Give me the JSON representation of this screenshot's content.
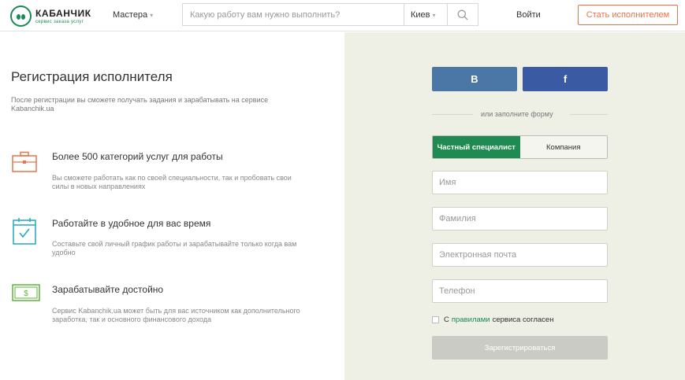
{
  "header": {
    "logo_name": "КАБАНЧИК",
    "logo_sub": "сервис заказа услуг",
    "masters_label": "Мастера",
    "search_placeholder": "Какую работу вам нужно выполнить?",
    "city": "Киев",
    "login_label": "Войти",
    "become_label": "Стать исполнителем"
  },
  "left": {
    "title": "Регистрация исполнителя",
    "intro": "После регистрации вы сможете получать задания и зарабатывать на сервисе Kabanchik.ua",
    "features": [
      {
        "icon": "briefcase-icon",
        "title": "Более 500 категорий услуг для работы",
        "desc": "Вы сможете работать как по своей специальности, так и пробовать свои силы в новых направлениях"
      },
      {
        "icon": "calendar-check-icon",
        "title": "Работайте в удобное для вас время",
        "desc": "Составьте свой личный график работы и зарабатывайте только когда вам удобно"
      },
      {
        "icon": "money-icon",
        "title": "Зарабатывайте достойно",
        "desc": "Сервис Kabanchik.ua может быть для вас источником как дополнительного заработка, так и основного финансового дохода"
      }
    ]
  },
  "form": {
    "vk_label": "B",
    "fb_label": "f",
    "or_text": "или заполните форму",
    "tab_person": "Частный специалист",
    "tab_company": "Компания",
    "name_placeholder": "Имя",
    "surname_placeholder": "Фамилия",
    "email_placeholder": "Электронная почта",
    "phone_placeholder": "Телефон",
    "agree_prefix": "С",
    "agree_link": "правилами",
    "agree_suffix": "сервиса согласен",
    "submit_label": "Зарегистрироваться"
  },
  "colors": {
    "brand_green": "#1a8a55",
    "accent_orange": "#e8734a",
    "icon_teal": "#23a6c4",
    "vk_blue": "#4b77a6",
    "fb_blue": "#3b5aa4"
  }
}
